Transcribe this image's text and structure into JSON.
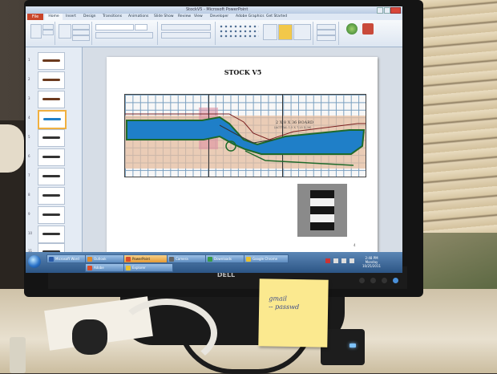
{
  "window": {
    "title": "StockV5 - Microsoft PowerPoint"
  },
  "ribbon": {
    "tabs": [
      "File",
      "Home",
      "Insert",
      "Design",
      "Transitions",
      "Animations",
      "Slide Show",
      "Review",
      "View",
      "Developer",
      "Adobe Graphics",
      "Get Started"
    ],
    "groups": [
      "Clipboard",
      "Slides",
      "Font",
      "Paragraph",
      "Drawing",
      "Editing"
    ]
  },
  "slide": {
    "title": "STOCK V5",
    "board_label": "2 X 8 X 36 BOARD",
    "board_sublabel": "(ACTUAL 1.5 X 7.25 X 36)"
  },
  "thumbnails": {
    "numbers": [
      "1",
      "2",
      "3",
      "4",
      "5",
      "6",
      "7",
      "8",
      "9",
      "10",
      "11"
    ]
  },
  "taskbar": {
    "buttons": [
      "Microsoft Word",
      "Outlook",
      "PowerPoint",
      "Camera",
      "Downloads",
      "Google Chrome",
      "Adobe",
      "Explorer"
    ],
    "clock_time": "2:48 PM",
    "clock_day": "Monday",
    "clock_date": "10/25/2011"
  },
  "monitor": {
    "brand": "DELL"
  },
  "sticky_note": {
    "text": "gmail\n-- passwd"
  },
  "colors": {
    "ppt_file_tab": "#c9452a",
    "stock_blue": "#1f7fc8",
    "stock_outline": "#1f6a2a",
    "sticky": "#fbe98f"
  }
}
